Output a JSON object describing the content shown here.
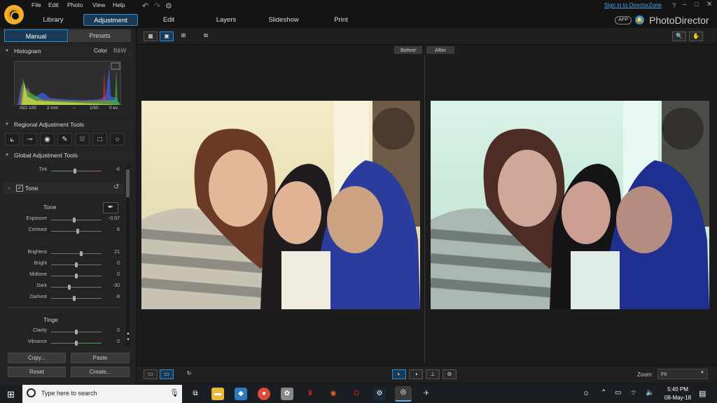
{
  "menu": {
    "file": "File",
    "edit": "Edit",
    "photo": "Photo",
    "view": "View",
    "help": "Help"
  },
  "topbar": {
    "sign_in": "Sign in to DirectorZone",
    "help": "?",
    "app_badge": "APP",
    "app_name": "PhotoDirector"
  },
  "main_tabs": [
    "Library",
    "Adjustment",
    "Edit",
    "Layers",
    "Slideshow",
    "Print"
  ],
  "panel_tabs": {
    "manual": "Manual",
    "presets": "Presets"
  },
  "histogram": {
    "title": "Histogram",
    "color": "Color",
    "bw": "B&W",
    "iso": "ISO 100",
    "focal": "2 mm",
    "dash": "--",
    "shutter": "1/50",
    "ev": "0 ev"
  },
  "regional": {
    "title": "Regional Adjustment Tools"
  },
  "global": {
    "title": "Global Adjustment Tools"
  },
  "tint": {
    "label": "Tint",
    "value": "-6"
  },
  "tone_section": {
    "label": "Tone",
    "subtitle": "Tone",
    "tinge": "Tinge"
  },
  "sliders": [
    {
      "label": "Exposure",
      "value": "-0.57",
      "level": 0.46
    },
    {
      "label": "Contrast",
      "value": "6",
      "level": 0.53
    },
    {
      "label": "Brightest",
      "value": "21",
      "level": 0.6
    },
    {
      "label": "Bright",
      "value": "0",
      "level": 0.5
    },
    {
      "label": "Midtone",
      "value": "0",
      "level": 0.5
    },
    {
      "label": "Dark",
      "value": "-30",
      "level": 0.35
    },
    {
      "label": "Darkest",
      "value": "-8",
      "level": 0.46
    },
    {
      "label": "Clarity",
      "value": "0",
      "level": 0.5
    },
    {
      "label": "Vibrance",
      "value": "0",
      "level": 0.5
    }
  ],
  "buttons": {
    "copy": "Copy...",
    "paste": "Paste",
    "reset": "Reset",
    "create": "Create..."
  },
  "compare": {
    "before": "Before",
    "after": "After"
  },
  "zoom": {
    "label": "Zoom:",
    "value": "Fit"
  },
  "taskbar": {
    "search_placeholder": "Type here to search",
    "time": "5:40 PM",
    "date": "08-May-18"
  },
  "colors": {
    "accent": "#2c8fd6",
    "panel": "#232323",
    "background": "#1c1c1c"
  }
}
